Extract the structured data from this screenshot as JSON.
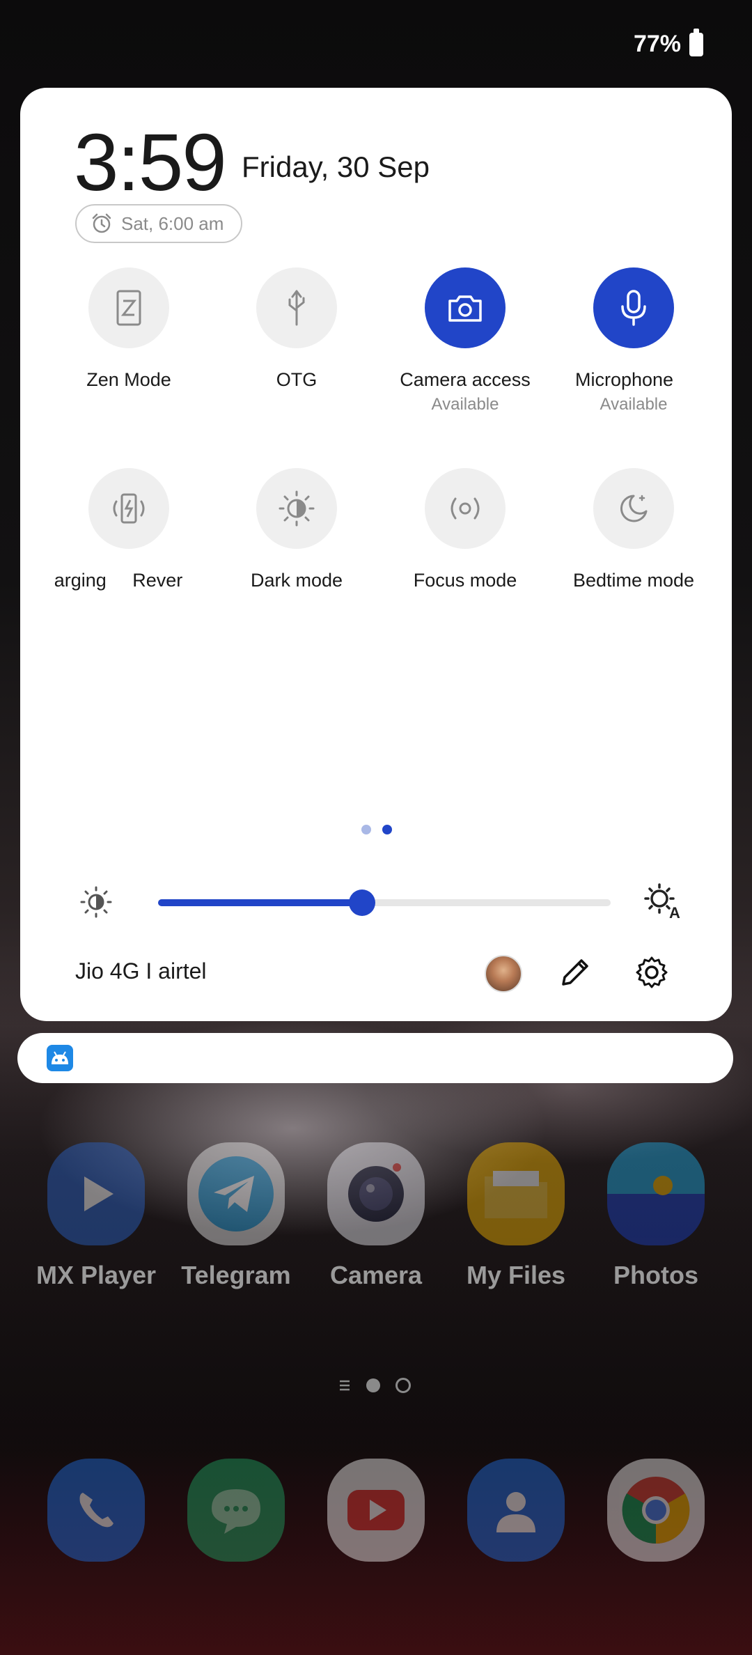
{
  "status": {
    "battery": "77%"
  },
  "header": {
    "time": "3:59",
    "date": "Friday, 30 Sep",
    "alarm": "Sat, 6:00 am"
  },
  "tiles_row1": [
    {
      "label": "Zen Mode",
      "sub": "",
      "active": false,
      "icon": "zen-mode-icon"
    },
    {
      "label": "OTG",
      "sub": "",
      "active": false,
      "icon": "usb-icon"
    },
    {
      "label": "Camera access",
      "sub": "Available",
      "active": true,
      "icon": "camera-icon"
    },
    {
      "label": "Microphone",
      "sub": "Available",
      "active": true,
      "icon": "microphone-icon"
    }
  ],
  "tiles_row2": [
    {
      "label": "arging     Rever",
      "sub": "",
      "active": false,
      "icon": "reverse-charging-icon"
    },
    {
      "label": "Dark mode",
      "sub": "",
      "active": false,
      "icon": "dark-mode-icon"
    },
    {
      "label": "Focus mode",
      "sub": "",
      "active": false,
      "icon": "focus-mode-icon"
    },
    {
      "label": "Bedtime mode",
      "sub": "",
      "active": false,
      "icon": "bedtime-mode-icon"
    }
  ],
  "brightness": {
    "level": 0.45,
    "accent": "#2145c8"
  },
  "footer": {
    "carrier": "Jio 4G I airtel"
  },
  "apps_row": [
    {
      "name": "MX Player",
      "color": "#2a63c8",
      "icon": "play-icon"
    },
    {
      "name": "Telegram",
      "color": "#2aa3e0",
      "icon": "telegram-icon"
    },
    {
      "name": "Camera",
      "color": "#e8e8ef",
      "icon": "camera-app-icon"
    },
    {
      "name": "My Files",
      "color": "#f4b400",
      "icon": "folder-icon"
    },
    {
      "name": "Photos",
      "color": "#1f9be0",
      "icon": "photos-icon"
    }
  ],
  "dock": [
    {
      "name": "Phone",
      "color": "#1e6fe0",
      "icon": "phone-icon"
    },
    {
      "name": "Messages",
      "color": "#1fa463",
      "icon": "messages-icon"
    },
    {
      "name": "YouTube",
      "color": "#f2f2f2",
      "icon": "youtube-icon"
    },
    {
      "name": "Contacts",
      "color": "#1e6fe0",
      "icon": "contacts-icon"
    },
    {
      "name": "Chrome",
      "color": "#eeeeee",
      "icon": "chrome-icon"
    }
  ]
}
